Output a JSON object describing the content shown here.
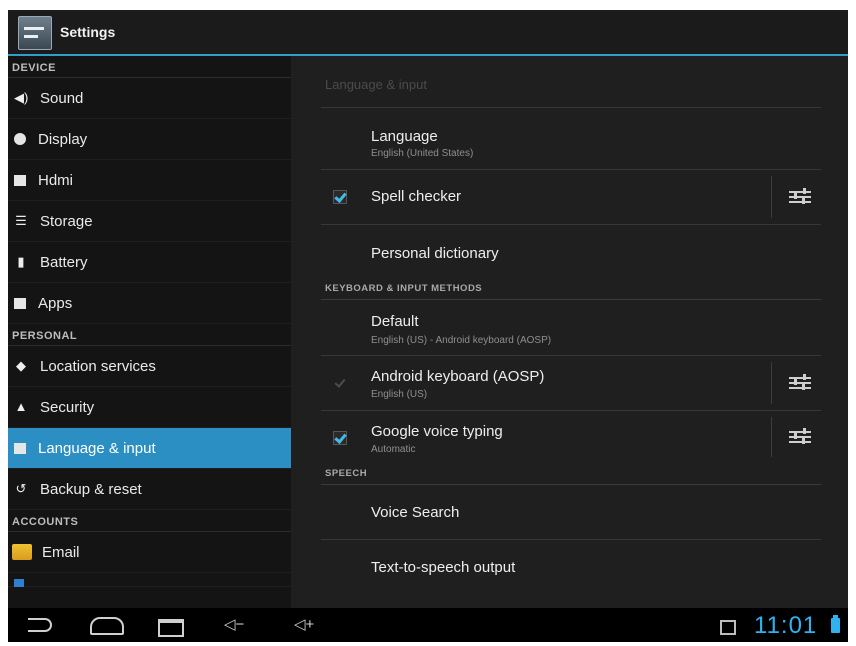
{
  "actionbar": {
    "title": "Settings",
    "app_icon": "settings-icon"
  },
  "sidebar": {
    "sections": [
      {
        "label": "DEVICE"
      },
      {
        "label": "PERSONAL"
      },
      {
        "label": "ACCOUNTS"
      }
    ],
    "items": [
      {
        "label": "Sound",
        "icon": "speaker-icon"
      },
      {
        "label": "Display",
        "icon": "brightness-icon"
      },
      {
        "label": "Hdmi",
        "icon": "hdmi-icon"
      },
      {
        "label": "Storage",
        "icon": "storage-icon"
      },
      {
        "label": "Battery",
        "icon": "battery-icon"
      },
      {
        "label": "Apps",
        "icon": "apps-icon"
      },
      {
        "label": "Location services",
        "icon": "location-icon"
      },
      {
        "label": "Security",
        "icon": "lock-icon"
      },
      {
        "label": "Language & input",
        "icon": "language-icon",
        "selected": true
      },
      {
        "label": "Backup & reset",
        "icon": "backup-icon"
      },
      {
        "label": "Email",
        "icon": "email-icon"
      }
    ]
  },
  "main": {
    "heading": "Language & input",
    "language": {
      "title": "Language",
      "summary": "English (United States)"
    },
    "spell_checker": {
      "title": "Spell checker",
      "checked": true
    },
    "personal_dictionary": {
      "title": "Personal dictionary"
    },
    "keyboard_section": "KEYBOARD & INPUT METHODS",
    "default": {
      "title": "Default",
      "summary": "English (US) - Android keyboard (AOSP)"
    },
    "android_keyboard": {
      "title": "Android keyboard (AOSP)",
      "summary": "English (US)",
      "checked": true,
      "disabled": true
    },
    "google_voice": {
      "title": "Google voice typing",
      "summary": "Automatic",
      "checked": true
    },
    "speech_section": "SPEECH",
    "voice_search": {
      "title": "Voice Search"
    },
    "tts": {
      "title": "Text-to-speech output"
    }
  },
  "navbar": {
    "vol_down": "◁−",
    "vol_up": "◁+",
    "clock": "11:01"
  },
  "colors": {
    "accent": "#2c8fc4",
    "clock": "#2fb3f0",
    "check": "#45b8ea"
  }
}
